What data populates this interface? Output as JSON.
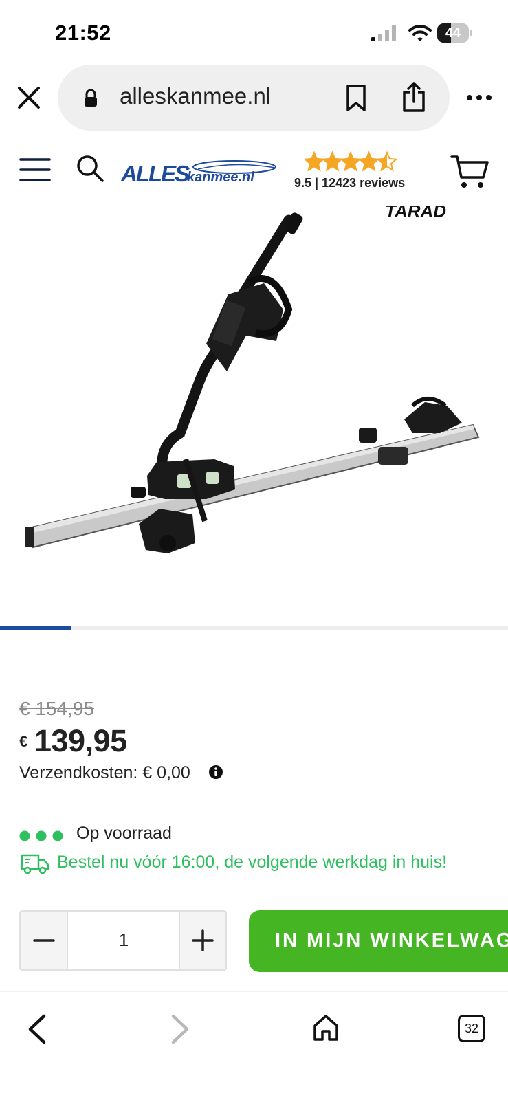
{
  "status_bar": {
    "time": "21:52",
    "battery": "44",
    "battery_level_percent": 44
  },
  "browser": {
    "url": "alleskanmee.nl",
    "tab_count": "32"
  },
  "site_header": {
    "logo_text": "ALLESkanmee.nl",
    "rating_stars": 4.5,
    "rating_text": "9.5 | 12423 reviews"
  },
  "gallery": {
    "brand_watermark": "TARAD",
    "progress_fraction": 0.14
  },
  "product": {
    "old_price": "€ 154,95",
    "currency": "€",
    "price": "139,95",
    "shipping": "Verzendkosten: € 0,00",
    "stock": "Op voorraad",
    "delivery": "Bestel nu vóór 16:00, de volgende werkdag in huis!",
    "quantity": "1",
    "add_to_cart": "IN MIJN WINKELWAGEN"
  },
  "colors": {
    "brand_blue": "#1d4a9c",
    "star_orange": "#f5a623",
    "stock_green": "#2ec05e",
    "button_green": "#45b524"
  },
  "icons": {
    "close": "close-icon",
    "lock": "lock-icon",
    "bookmark": "bookmark-icon",
    "share": "share-icon",
    "more": "more-icon",
    "menu": "hamburger-icon",
    "search": "search-icon",
    "cart": "cart-icon",
    "info": "info-icon",
    "truck": "truck-icon",
    "back": "chevron-left-icon",
    "forward": "chevron-right-icon",
    "home": "home-icon"
  }
}
